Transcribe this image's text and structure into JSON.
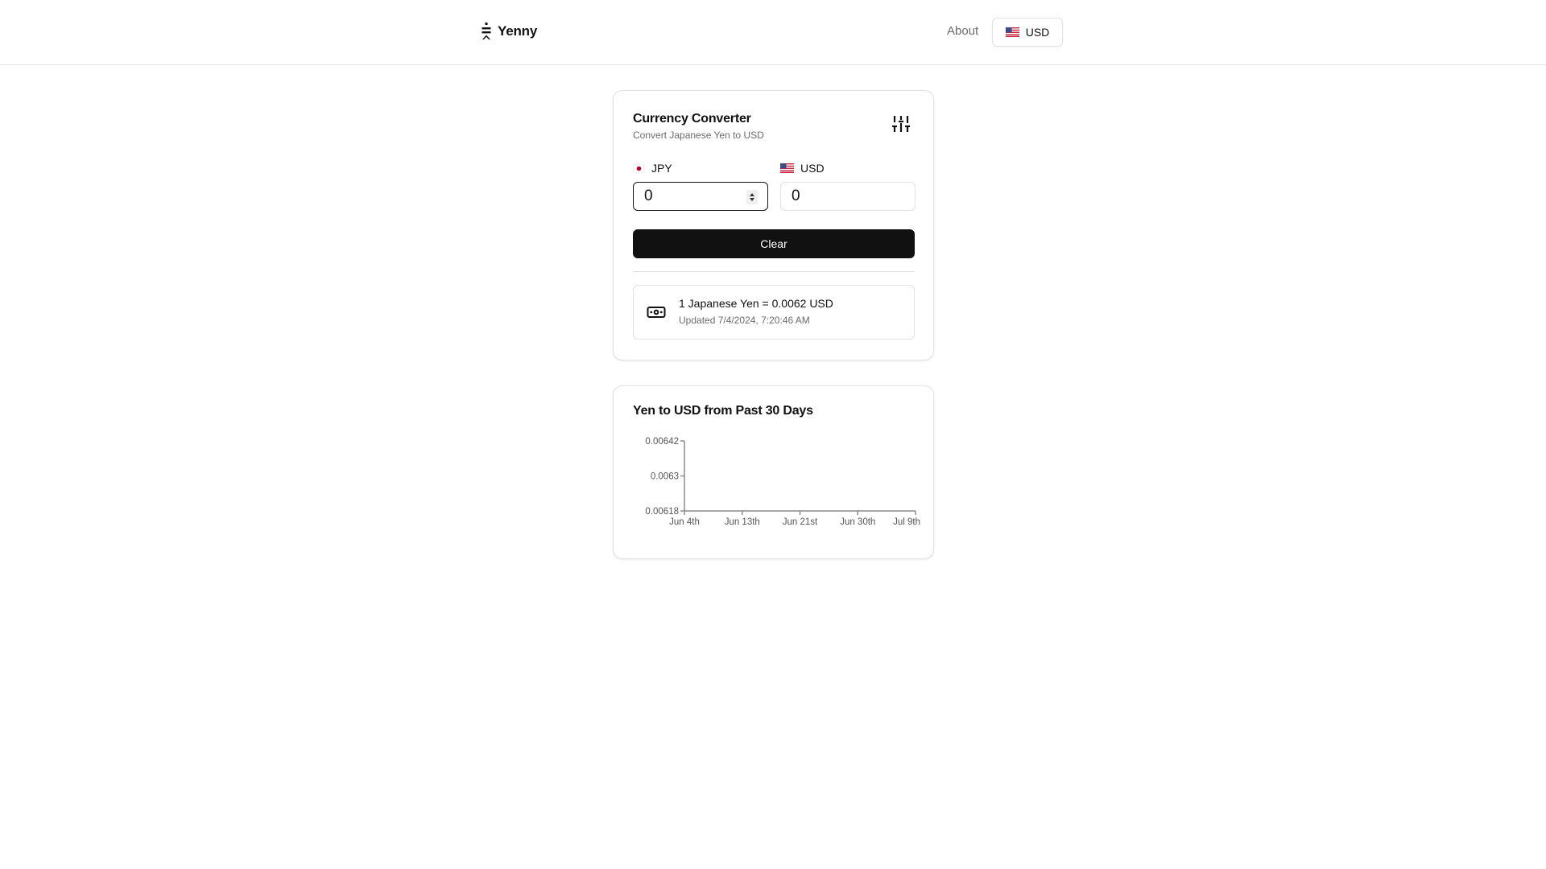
{
  "header": {
    "app_name": "Yenny",
    "nav_about": "About",
    "currency_button": {
      "label": "USD",
      "flag": "us-flag-icon"
    }
  },
  "converter": {
    "title": "Currency Converter",
    "subtitle": "Convert Japanese Yen to USD",
    "settings_icon": "sliders-icon",
    "from": {
      "code": "JPY",
      "flag": "jp-flag-icon",
      "value": "0"
    },
    "to": {
      "code": "USD",
      "flag": "us-flag-icon",
      "value": "0"
    },
    "clear_label": "Clear",
    "rate": {
      "icon": "banknote-icon",
      "text": "1 Japanese Yen = 0.0062 USD",
      "updated": "Updated 7/4/2024, 7:20:46 AM"
    }
  },
  "chart_card": {
    "title": "Yen to USD from Past 30 Days"
  },
  "chart_data": {
    "type": "line",
    "title": "Yen to USD from Past 30 Days",
    "xlabel": "",
    "ylabel": "",
    "x_tick_labels": [
      "Jun 4th",
      "Jun 13th",
      "Jun 21st",
      "Jun 30th",
      "Jul 9th"
    ],
    "y_tick_labels": [
      "0.00618",
      "0.0063",
      "0.00642"
    ],
    "y_ticks": [
      0.00618,
      0.0063,
      0.00642
    ],
    "ylim": [
      0.00618,
      0.00642
    ],
    "x": [],
    "values": [],
    "grid": false,
    "legend": "none"
  }
}
